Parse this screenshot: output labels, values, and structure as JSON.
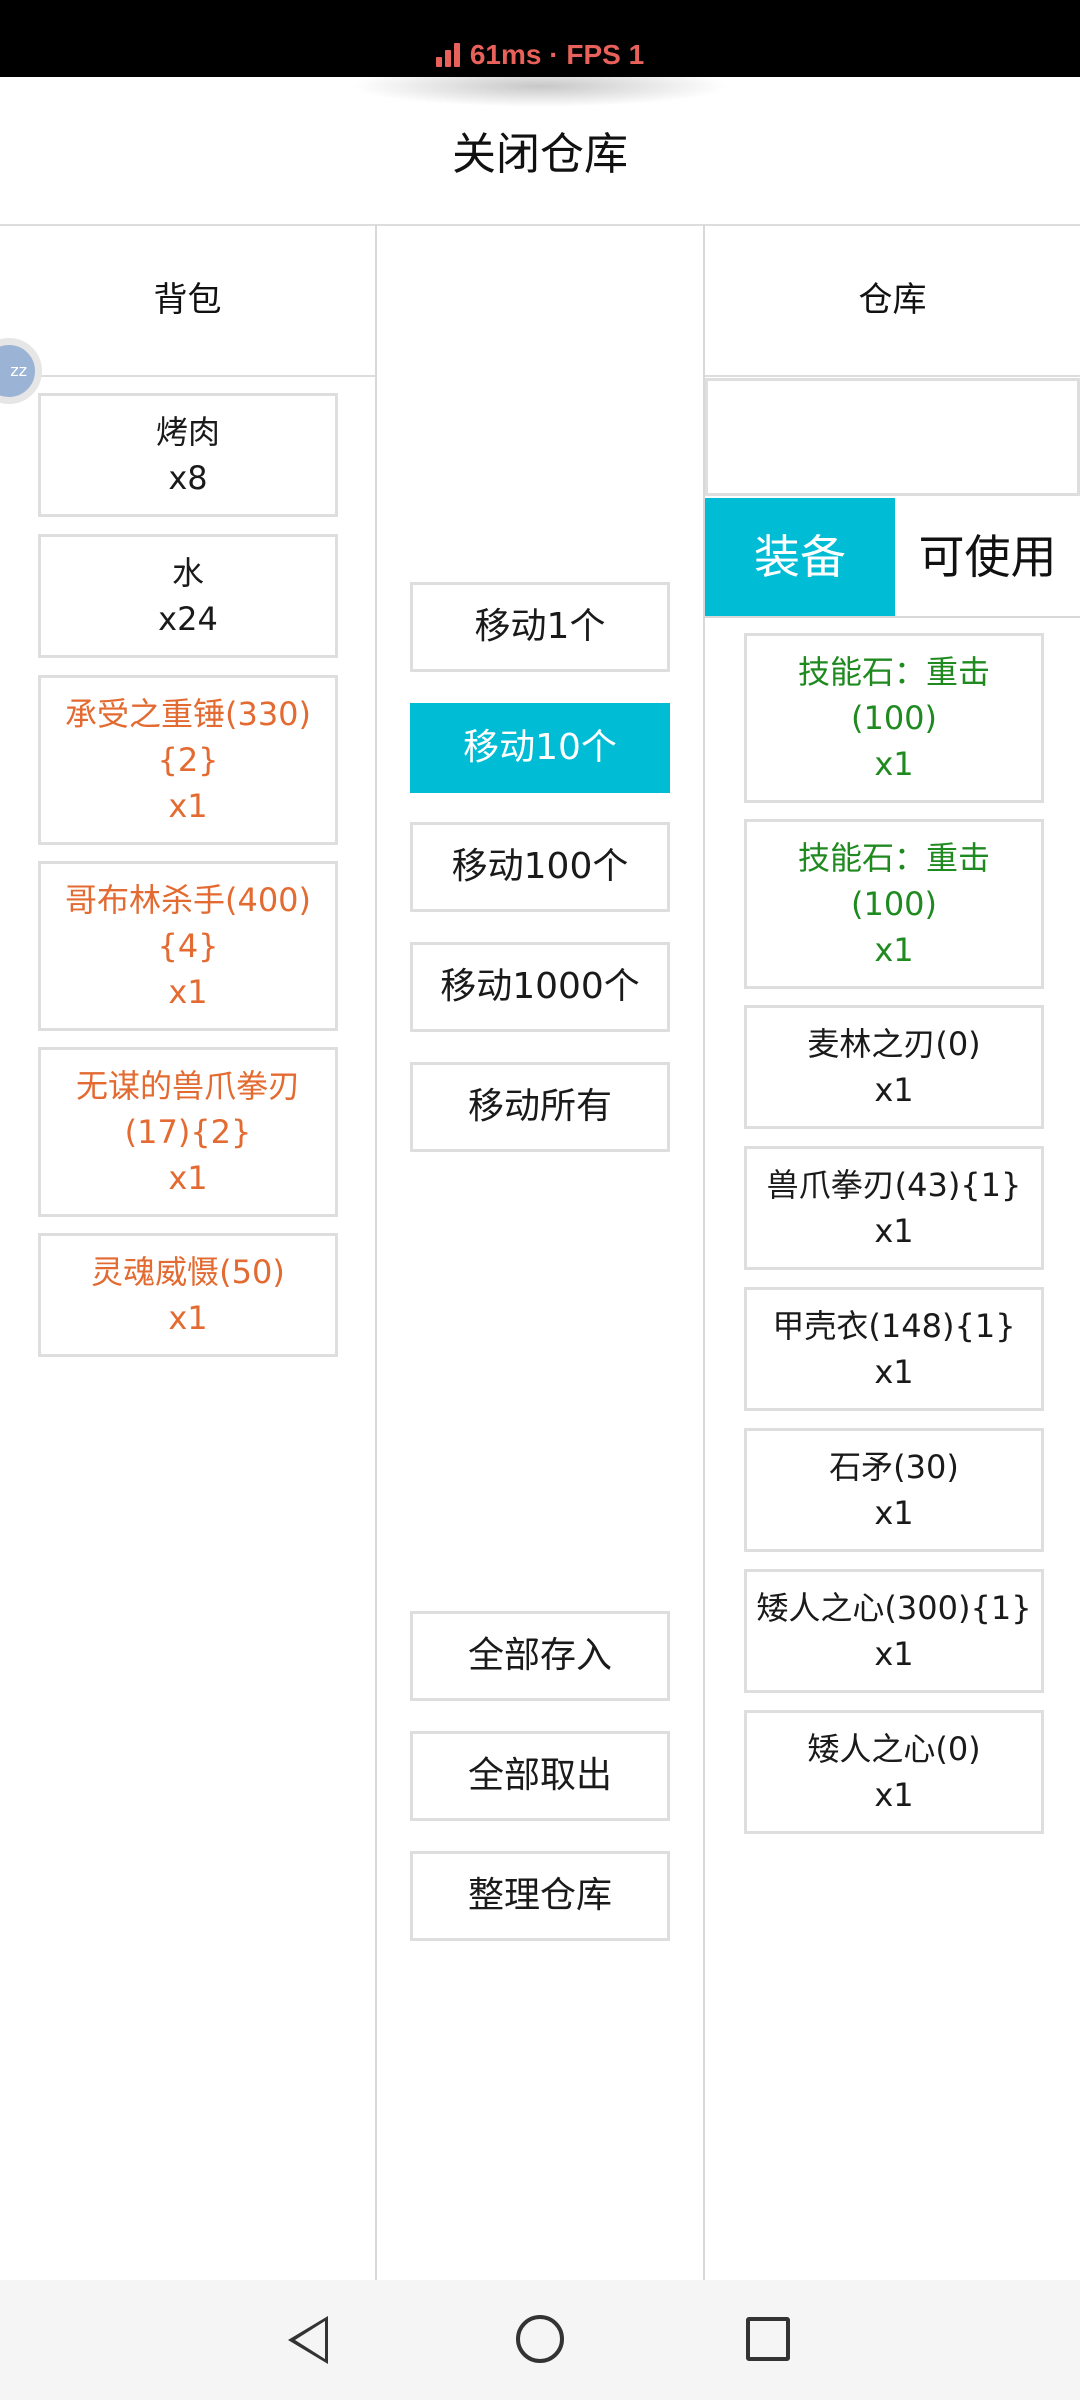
{
  "status_bar": {
    "latency": "61ms · FPS 1"
  },
  "colors": {
    "accent": "#00bcd4",
    "rare_text": "#e36a30",
    "skill_text": "#1f8a20"
  },
  "header": {
    "title": "关闭仓库"
  },
  "backpack": {
    "title": "背包",
    "items": [
      {
        "name": "烤肉",
        "count": "x8",
        "color": "normal"
      },
      {
        "name": "水",
        "count": "x24",
        "color": "normal"
      },
      {
        "name_lines": [
          "承受之重锤(330)",
          "{2}"
        ],
        "count": "x1",
        "color": "orange"
      },
      {
        "name_lines": [
          "哥布林杀手(400)",
          "{4}"
        ],
        "count": "x1",
        "color": "orange"
      },
      {
        "name_lines": [
          "无谋的兽爪拳刃",
          "(17){2}"
        ],
        "count": "x1",
        "color": "orange"
      },
      {
        "name": "灵魂威慑(50)",
        "count": "x1",
        "color": "orange"
      }
    ]
  },
  "middle": {
    "move_buttons": [
      "移动1个",
      "移动10个",
      "移动100个",
      "移动1000个",
      "移动所有"
    ],
    "active_move": "移动10个",
    "bulk_buttons": [
      "全部存入",
      "全部取出",
      "整理仓库"
    ]
  },
  "warehouse": {
    "title": "仓库",
    "search_value": "",
    "tabs": [
      "装备",
      "可使用"
    ],
    "active_tab": "装备",
    "items": [
      {
        "name_lines": [
          "技能石：重击",
          "(100)"
        ],
        "count": "x1",
        "color": "green"
      },
      {
        "name_lines": [
          "技能石：重击",
          "(100)"
        ],
        "count": "x1",
        "color": "green"
      },
      {
        "name": "麦林之刃(0)",
        "count": "x1",
        "color": "normal"
      },
      {
        "name": "兽爪拳刃(43){1}",
        "count": "x1",
        "color": "normal"
      },
      {
        "name": "甲壳衣(148){1}",
        "count": "x1",
        "color": "normal"
      },
      {
        "name": "石矛(30)",
        "count": "x1",
        "color": "normal"
      },
      {
        "name": "矮人之心(300){1}",
        "count": "x1",
        "color": "normal"
      },
      {
        "name": "矮人之心(0)",
        "count": "x1",
        "color": "normal"
      }
    ]
  },
  "avatar": {
    "text": "zz"
  }
}
